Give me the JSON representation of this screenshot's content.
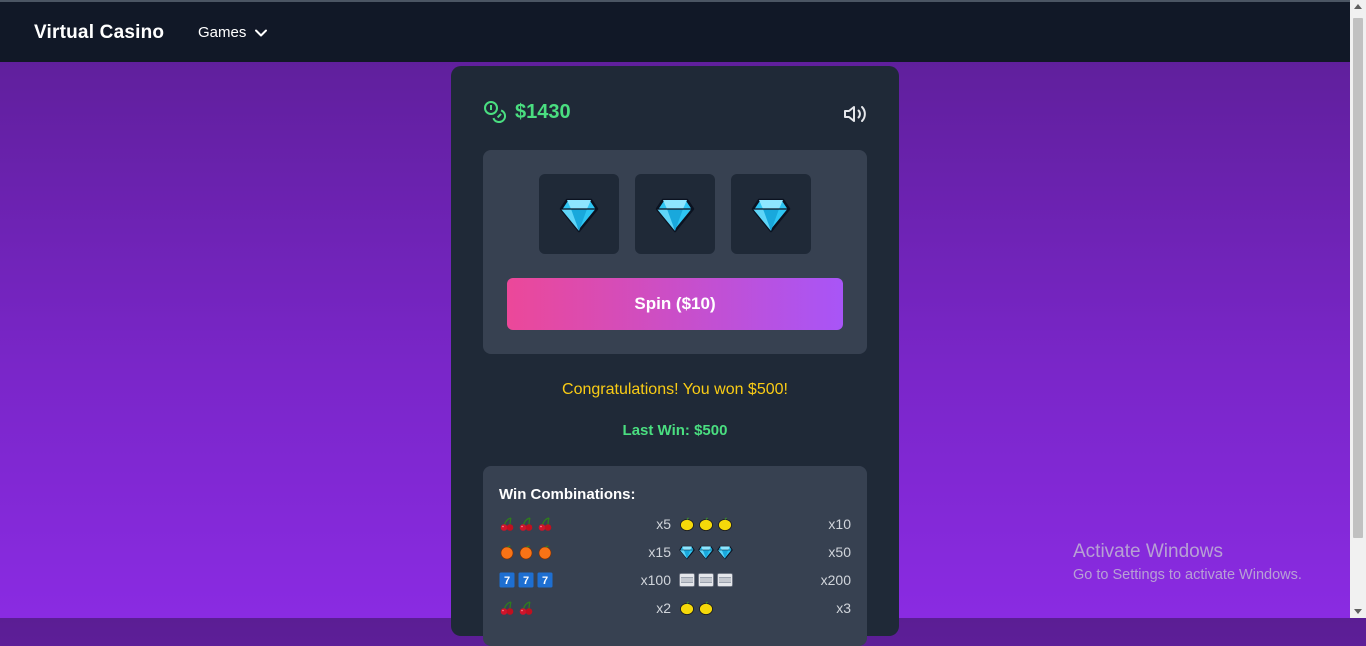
{
  "nav": {
    "brand": "Virtual Casino",
    "games_label": "Games"
  },
  "balance": {
    "amount": "$1430"
  },
  "reels": [
    "diamond",
    "diamond",
    "diamond"
  ],
  "spin": {
    "label": "Spin ($10)"
  },
  "message": "Congratulations! You won $500!",
  "last_win": "Last Win: $500",
  "combos": {
    "title": "Win Combinations:",
    "rows": [
      {
        "left": {
          "symbols": [
            "cherry",
            "cherry",
            "cherry"
          ],
          "mult": "x5"
        },
        "right": {
          "symbols": [
            "lemon",
            "lemon",
            "lemon"
          ],
          "mult": "x10"
        }
      },
      {
        "left": {
          "symbols": [
            "orange",
            "orange",
            "orange"
          ],
          "mult": "x15"
        },
        "right": {
          "symbols": [
            "diamond",
            "diamond",
            "diamond"
          ],
          "mult": "x50"
        }
      },
      {
        "left": {
          "symbols": [
            "seven",
            "seven",
            "seven"
          ],
          "mult": "x100"
        },
        "right": {
          "symbols": [
            "bar",
            "bar",
            "bar"
          ],
          "mult": "x200"
        }
      },
      {
        "left": {
          "symbols": [
            "cherry",
            "cherry"
          ],
          "mult": "x2"
        },
        "right": {
          "symbols": [
            "lemon",
            "lemon"
          ],
          "mult": "x3"
        }
      }
    ]
  },
  "watermark": {
    "line1": "Activate Windows",
    "line2": "Go to Settings to activate Windows."
  },
  "colors": {
    "accent_green": "#4ade80",
    "message_yellow": "#facc15",
    "spin_from": "#ec4899",
    "spin_to": "#a855f7"
  }
}
